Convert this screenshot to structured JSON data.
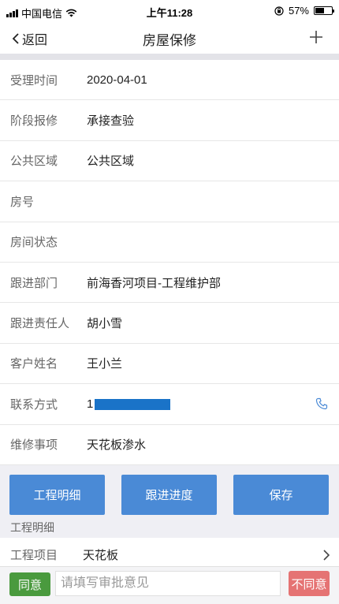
{
  "status_bar": {
    "carrier": "中国电信",
    "time": "上午11:28",
    "battery": "57%",
    "battery_level": 0.57
  },
  "nav": {
    "back_label": "返回",
    "title": "房屋保修",
    "add_icon": "plus-icon"
  },
  "form": {
    "rows": [
      {
        "label": "受理时间",
        "value": "2020-04-01"
      },
      {
        "label": "阶段报修",
        "value": "承接查验"
      },
      {
        "label": "公共区域",
        "value": "公共区域"
      },
      {
        "label": "房号",
        "value": ""
      },
      {
        "label": "房间状态",
        "value": ""
      },
      {
        "label": "跟进部门",
        "value": "前海香河项目-工程维护部"
      },
      {
        "label": "跟进责任人",
        "value": "胡小雪"
      },
      {
        "label": "客户姓名",
        "value": "王小兰"
      },
      {
        "label": "联系方式",
        "value": "1"
      },
      {
        "label": "维修事项",
        "value": "天花板渗水"
      }
    ]
  },
  "actions": {
    "detail_label": "工程明细",
    "progress_label": "跟进进度",
    "save_label": "保存"
  },
  "detail_section": {
    "header": "工程明细",
    "item_label": "工程项目",
    "item_value": "天花板"
  },
  "bottom": {
    "agree_label": "同意",
    "opinion_placeholder": "请填写审批意见",
    "disagree_label": "不同意"
  },
  "colors": {
    "primary_button": "#4a8ad6",
    "agree": "#4a9a3e",
    "disagree": "#e57373"
  }
}
